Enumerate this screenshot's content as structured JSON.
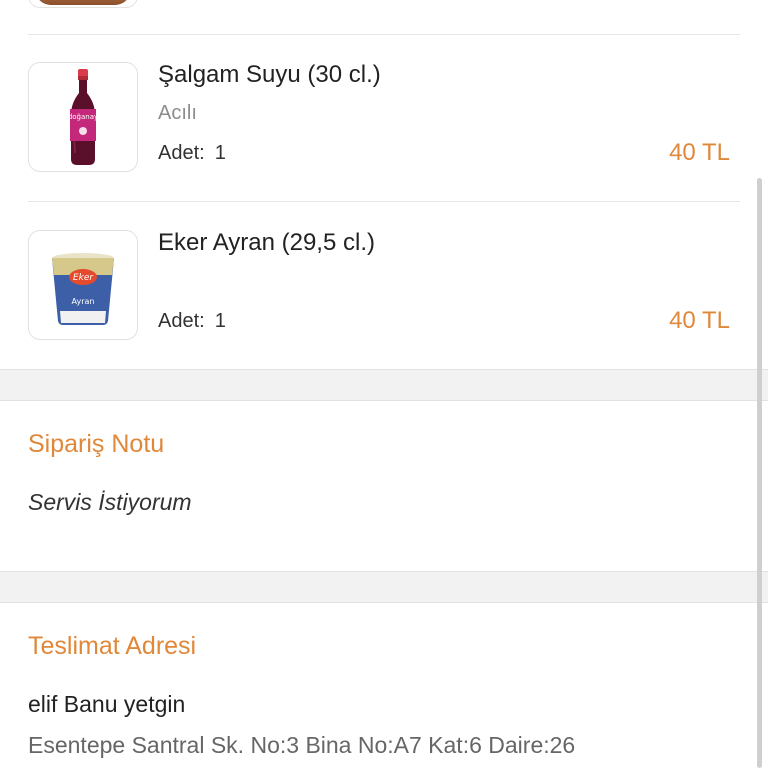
{
  "order": {
    "items": [
      {
        "name": "Şalgam Suyu (30 cl.)",
        "option": "Acılı",
        "qty_label": "Adet:",
        "qty": "1",
        "price": "40 TL",
        "image": "salgam-bottle",
        "brand_text": "doğanay"
      },
      {
        "name": "Eker Ayran (29,5 cl.)",
        "option": "",
        "qty_label": "Adet:",
        "qty": "1",
        "price": "40 TL",
        "image": "ayran-cup",
        "brand_text": "Eker",
        "sub_text": "Ayran"
      }
    ]
  },
  "note": {
    "title": "Sipariş Notu",
    "text": "Servis İstiyorum"
  },
  "address": {
    "title": "Teslimat Adresi",
    "name": "elif Banu yetgin",
    "line": "Esentepe Santral Sk. No:3 Bina No:A7  Kat:6 Daire:26"
  },
  "colors": {
    "accent": "#e0883a",
    "text": "#222222",
    "muted": "#8c8c8c",
    "band": "#f2f2f2"
  }
}
